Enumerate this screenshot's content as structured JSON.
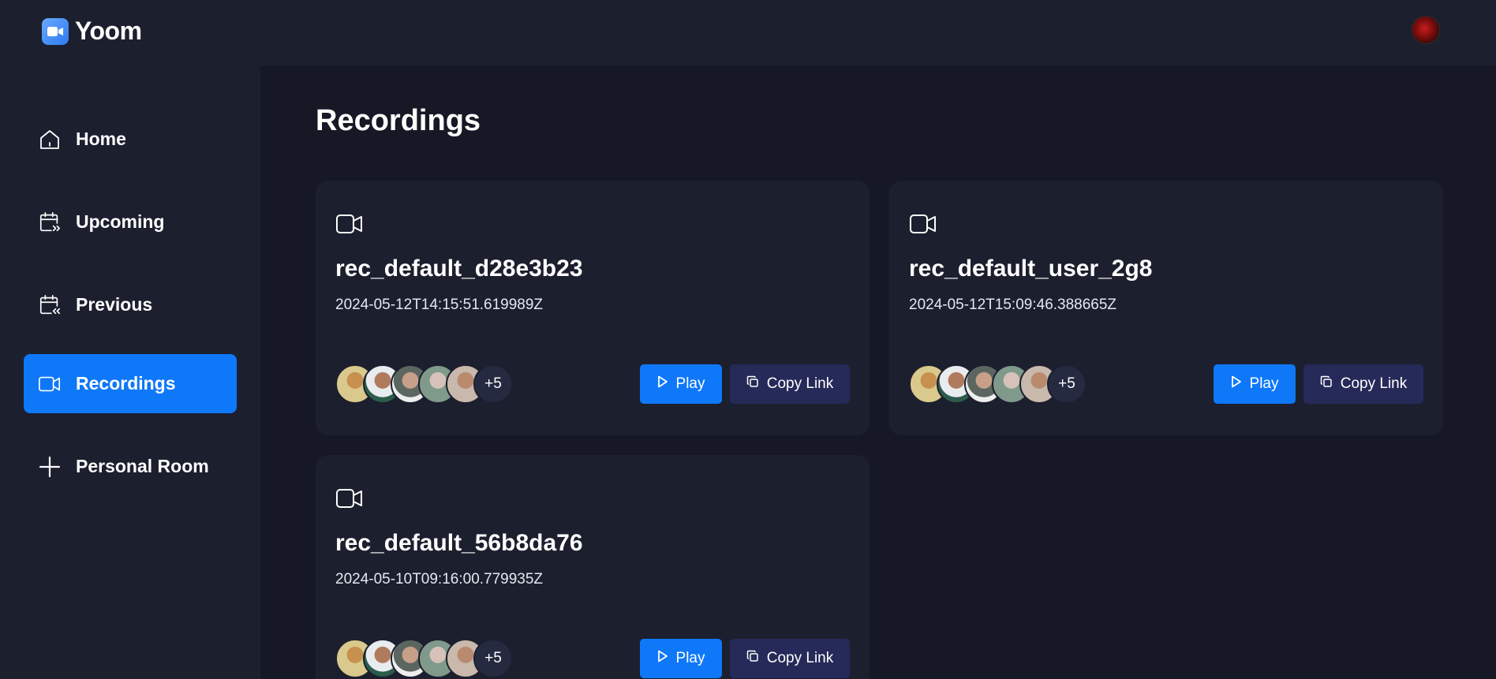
{
  "app": {
    "name": "Yoom"
  },
  "sidebar": {
    "items": [
      {
        "label": "Home",
        "icon": "home-icon",
        "active": false
      },
      {
        "label": "Upcoming",
        "icon": "calendar-forward-icon",
        "active": false
      },
      {
        "label": "Previous",
        "icon": "calendar-back-icon",
        "active": false
      },
      {
        "label": "Recordings",
        "icon": "video-icon",
        "active": true
      },
      {
        "label": "Personal Room",
        "icon": "plus-icon",
        "active": false
      }
    ]
  },
  "page": {
    "title": "Recordings"
  },
  "recordings": [
    {
      "title": "rec_default_d28e3b23",
      "date": "2024-05-12T14:15:51.619989Z",
      "more_attendees": "+5",
      "play_label": "Play",
      "copy_label": "Copy Link"
    },
    {
      "title": "rec_default_user_2g8",
      "date": "2024-05-12T15:09:46.388665Z",
      "more_attendees": "+5",
      "play_label": "Play",
      "copy_label": "Copy Link"
    },
    {
      "title": "rec_default_56b8da76",
      "date": "2024-05-10T09:16:00.779935Z",
      "more_attendees": "+5",
      "play_label": "Play",
      "copy_label": "Copy Link"
    }
  ],
  "colors": {
    "accent": "#0e78f9",
    "background": "#161925",
    "panel": "#1c1f2e",
    "copy_button": "#252a59"
  }
}
